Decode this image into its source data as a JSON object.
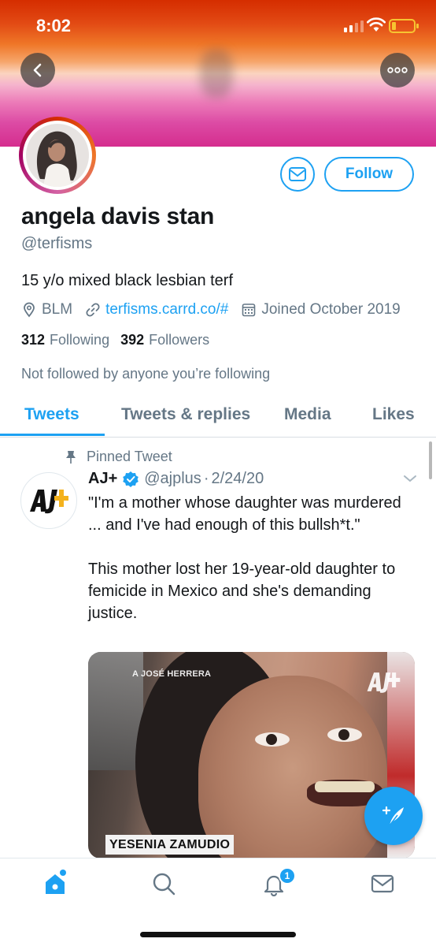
{
  "status_bar": {
    "time": "8:02"
  },
  "profile": {
    "display_name": "angela davis stan",
    "handle": "@terfisms",
    "bio": "15 y/o mixed black lesbian terf",
    "location": "BLM",
    "website": "terfisms.carrd.co/#",
    "joined": "Joined October 2019",
    "following_count": "312",
    "following_label": "Following",
    "followers_count": "392",
    "followers_label": "Followers",
    "followed_by_note": "Not followed by anyone you’re following",
    "follow_button_label": "Follow"
  },
  "tabs": [
    {
      "label": "Tweets",
      "active": true
    },
    {
      "label": "Tweets & replies",
      "active": false
    },
    {
      "label": "Media",
      "active": false
    },
    {
      "label": "Likes",
      "active": false
    }
  ],
  "pinned_tweet": {
    "pinned_label": "Pinned Tweet",
    "author": "AJ+",
    "handle": "@ajplus",
    "separator": "·",
    "date": "2/24/20",
    "text": "\"I'm a mother whose daughter was murdered ... and I've had enough of this bullsh*t.\"\n\nThis mother lost her 19-year-old daughter to femicide in Mexico and she's demanding justice.",
    "media": {
      "top_caption": "A JOSÉ HERRERA",
      "name_caption": "YESENIA ZAMUDIO"
    }
  },
  "bottom_nav": {
    "notification_badge": "1"
  },
  "colors": {
    "accent": "#1da1f2",
    "text": "#14171a",
    "muted": "#657786"
  },
  "icons": {
    "back": "back-arrow-icon",
    "more": "more-dots-icon",
    "message": "envelope-icon",
    "location": "location-pin-icon",
    "link": "link-icon",
    "calendar": "calendar-icon",
    "pin": "pin-icon",
    "verified": "verified-badge-icon",
    "chevron": "chevron-down-icon",
    "compose": "compose-tweet-icon",
    "home": "home-icon",
    "search": "search-icon",
    "notifications": "bell-icon",
    "messages": "envelope-icon"
  }
}
